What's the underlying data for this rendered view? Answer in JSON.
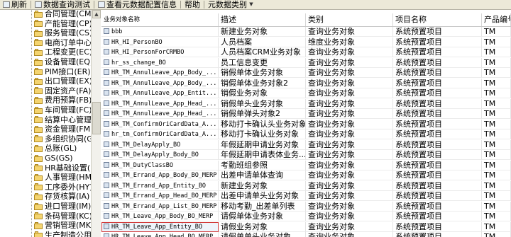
{
  "toolbar": {
    "refresh_label": "刷新",
    "query_test_label": "数据查询测试",
    "view_meta_label": "查看元数据配置信息",
    "help_label": "帮助",
    "meta_type_label": "元数据类别"
  },
  "tree": {
    "items": [
      "合同管理(CM)",
      "产能管理(CP)",
      "服务管理(CS)",
      "电商订单中心",
      "工程变更(EC)",
      "设备管理(EQ)",
      "PIM接口(ER)",
      "出口管理(EX)",
      "固定资产(FA)",
      "费用预算(FB)",
      "车间管理(FC)",
      "结算中心管理",
      "资金管理(FM)",
      "多组织协同(G",
      "总账(GL)",
      "GS(GS)",
      "HR基础设置(H",
      "人事管理(HM)",
      "工序委外(HY)",
      "存货核算(IA)",
      "进口管理(IM)",
      "条码管理(KC)",
      "营销管理(MK)",
      "生产制造公用"
    ]
  },
  "table": {
    "columns": [
      "业务对象名称",
      "描述",
      "类别",
      "项目名称",
      "产品编号"
    ],
    "rows": [
      [
        "bbb",
        "新建业务对象",
        "查询业务对象",
        "系统预置项目",
        "TM"
      ],
      [
        "HR_HI_PersonBO",
        "人员档案",
        "维度业务对象",
        "系统预置项目",
        "TM"
      ],
      [
        "HR_HI_PersonForCRMBO",
        "人员档案CRM业务对象",
        "查询业务对象",
        "系统预置项目",
        "TM"
      ],
      [
        "hr_ss_change_BO",
        "员工信息变更",
        "查询业务对象",
        "系统预置项目",
        "TM"
      ],
      [
        "HR_TM_AnnulLeave_App_Body_...",
        "销假单体业务对象",
        "查询业务对象",
        "系统预置项目",
        "TM"
      ],
      [
        "HR_TM_AnnulLeave_App_Body_...",
        "销假单体业务对象2",
        "查询业务对象",
        "系统预置项目",
        "TM"
      ],
      [
        "HR_TM_AnnulLeave_App_Entit...",
        "销假业务对象",
        "查询业务对象",
        "系统预置项目",
        "TM"
      ],
      [
        "HR_TM_AnnulLeave_App_Head_...",
        "销假单头业务对象",
        "查询业务对象",
        "系统预置项目",
        "TM"
      ],
      [
        "HR_TM_AnnulLeave_App_Head_...",
        "销假单弹头对象2",
        "查询业务对象",
        "系统预置项目",
        "TM"
      ],
      [
        "HR_TM_ConfirmOriCardData_A...",
        "移动打卡确认头业务对象",
        "查询业务对象",
        "系统预置项目",
        "TM"
      ],
      [
        "hr_tm_ConfirmOriCardData_A...",
        "移动打卡确认业务对象",
        "查询业务对象",
        "系统预置项目",
        "TM"
      ],
      [
        "HR_TM_DelayApply_BO",
        "年假延期申请业务对象",
        "查询业务对象",
        "系统预置项目",
        "TM"
      ],
      [
        "HR_TM_DelayApply_Body_BO",
        "年假延期申请表体业务...",
        "查询业务对象",
        "系统预置项目",
        "TM"
      ],
      [
        "HR_TM_DutyClassBO",
        "考勤班组参照",
        "查询业务对象",
        "系统预置项目",
        "TM"
      ],
      [
        "HR_TM_Errand_App_Body_BO_MERP",
        "出差申请单体查询",
        "查询业务对象",
        "系统预置项目",
        "TM"
      ],
      [
        "HR_TM_Errand_App_Entity_BO",
        "新建业务对象",
        "查询业务对象",
        "系统预置项目",
        "TM"
      ],
      [
        "HR_TM_Errand_App_Head_BO_MERP",
        "出差申请单头业务对象",
        "查询业务对象",
        "系统预置项目",
        "TM"
      ],
      [
        "HR_TM_Errand_App_List_BO_MERP",
        "移动考勤_出差单列表",
        "查询业务对象",
        "系统预置项目",
        "TM"
      ],
      [
        "HR_TM_Leave_App_Body_BO_MERP",
        "请假单体业务对象",
        "查询业务对象",
        "系统预置项目",
        "TM"
      ],
      [
        "HR_TM_Leave_App_Entity_BO",
        "请假业务对象",
        "查询业务对象",
        "系统预置项目",
        "TM"
      ],
      [
        "HR_TM_Leave_App_Head_BO_MERP",
        "请假单单头业务对象",
        "查询业务对象",
        "系统预置项目",
        "TM"
      ]
    ]
  }
}
